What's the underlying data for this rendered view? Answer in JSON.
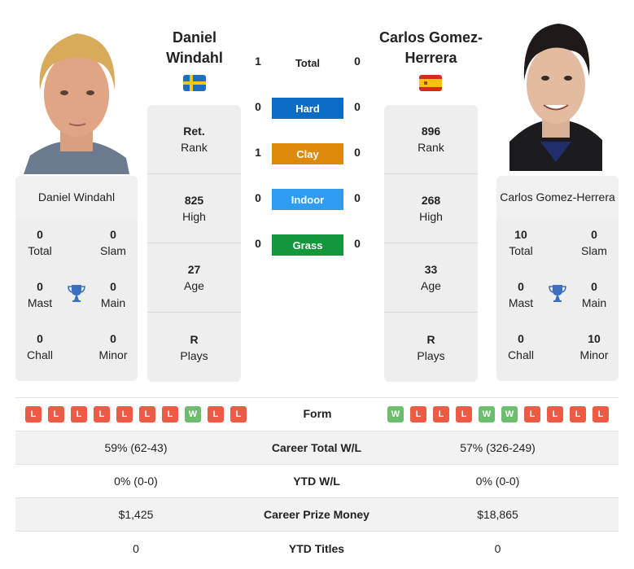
{
  "player1": {
    "name": "Daniel Windahl",
    "name_line1": "Daniel",
    "name_line2": "Windahl",
    "country_flag": "sweden-flag",
    "stats": [
      {
        "value": "Ret.",
        "label": "Rank"
      },
      {
        "value": "825",
        "label": "High"
      },
      {
        "value": "27",
        "label": "Age"
      },
      {
        "value": "R",
        "label": "Plays"
      }
    ],
    "titles": {
      "total": {
        "value": "0",
        "label": "Total"
      },
      "slam": {
        "value": "0",
        "label": "Slam"
      },
      "mast": {
        "value": "0",
        "label": "Mast"
      },
      "main": {
        "value": "0",
        "label": "Main"
      },
      "chall": {
        "value": "0",
        "label": "Chall"
      },
      "minor": {
        "value": "0",
        "label": "Minor"
      }
    },
    "form": [
      "L",
      "L",
      "L",
      "L",
      "L",
      "L",
      "L",
      "W",
      "L",
      "L"
    ]
  },
  "player2": {
    "name": "Carlos Gomez-Herrera",
    "name_line1": "Carlos Gomez-",
    "name_line2": "Herrera",
    "country_flag": "spain-flag",
    "stats": [
      {
        "value": "896",
        "label": "Rank"
      },
      {
        "value": "268",
        "label": "High"
      },
      {
        "value": "33",
        "label": "Age"
      },
      {
        "value": "R",
        "label": "Plays"
      }
    ],
    "titles": {
      "total": {
        "value": "10",
        "label": "Total"
      },
      "slam": {
        "value": "0",
        "label": "Slam"
      },
      "mast": {
        "value": "0",
        "label": "Mast"
      },
      "main": {
        "value": "0",
        "label": "Main"
      },
      "chall": {
        "value": "0",
        "label": "Chall"
      },
      "minor": {
        "value": "10",
        "label": "Minor"
      }
    },
    "form": [
      "W",
      "L",
      "L",
      "L",
      "W",
      "W",
      "L",
      "L",
      "L",
      "L"
    ]
  },
  "h2h": [
    {
      "label": "Total",
      "p1": "1",
      "p2": "0",
      "color": ""
    },
    {
      "label": "Hard",
      "p1": "0",
      "p2": "0",
      "color": "#0a6cc2"
    },
    {
      "label": "Clay",
      "p1": "1",
      "p2": "0",
      "color": "#dd8a0b"
    },
    {
      "label": "Indoor",
      "p1": "0",
      "p2": "0",
      "color": "#2d9cf2"
    },
    {
      "label": "Grass",
      "p1": "0",
      "p2": "0",
      "color": "#12973a"
    }
  ],
  "form_label": "Form",
  "comparison": [
    {
      "label": "Career Total W/L",
      "p1": "59% (62-43)",
      "p2": "57% (326-249)"
    },
    {
      "label": "YTD W/L",
      "p1": "0% (0-0)",
      "p2": "0% (0-0)"
    },
    {
      "label": "Career Prize Money",
      "p1": "$1,425",
      "p2": "$18,865"
    },
    {
      "label": "YTD Titles",
      "p1": "0",
      "p2": "0"
    }
  ],
  "colors": {
    "loss": "#ee5b45",
    "win": "#6cbd6e",
    "trophy": "#3b6fc0"
  }
}
